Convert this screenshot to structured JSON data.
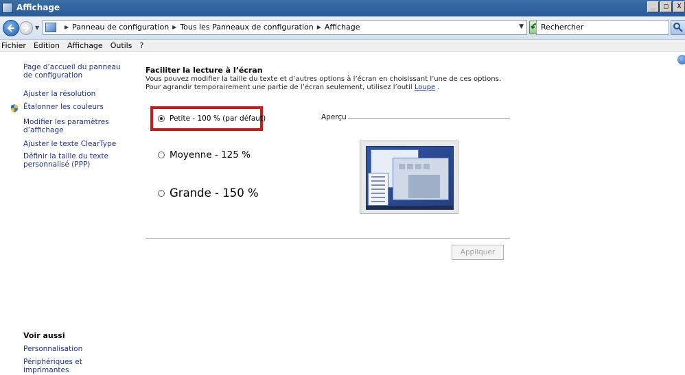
{
  "window": {
    "title": "Affichage",
    "minimize": "_",
    "maximize": "□",
    "close": "X"
  },
  "address": {
    "crumbs": [
      "Panneau de configuration",
      "Tous les Panneaux de configuration",
      "Affichage"
    ],
    "search_placeholder": "Rechercher"
  },
  "menu": [
    "Fichier",
    "Edition",
    "Affichage",
    "Outils",
    "?"
  ],
  "sidebar": {
    "links": [
      "Page d’accueil du panneau de configuration",
      "Ajuster la résolution",
      "Étalonner les couleurs",
      "Modifier les paramètres d’affichage",
      "Ajuster le texte ClearType",
      "Définir la taille du texte personnalisé (PPP)"
    ],
    "see_also_title": "Voir aussi",
    "see_also": [
      "Personnalisation",
      "Périphériques et imprimantes"
    ]
  },
  "main": {
    "heading": "Faciliter la lecture à l’écran",
    "description": "Vous pouvez modifier la taille du texte et d’autres options à l’écran en choisissant l’une de ces options. Pour agrandir temporairement une partie de l’écran seulement, utilisez l’outil",
    "loupe_link": "Loupe",
    "description_end": " .",
    "options": [
      {
        "label": "Petite - 100 % (par défaut)",
        "checked": true
      },
      {
        "label": "Moyenne - 125 %",
        "checked": false
      },
      {
        "label": "Grande - 150 %",
        "checked": false
      }
    ],
    "preview_label": "Aperçu",
    "apply_label": "Appliquer"
  },
  "colors": {
    "highlight": "#cc1a1a",
    "link": "#1e3287",
    "titlebar": "#3a6ea5"
  },
  "icons": [
    "back-arrow-icon",
    "forward-arrow-icon",
    "control-panel-icon",
    "refresh-icon",
    "search-icon",
    "shield-icon",
    "help-icon"
  ]
}
